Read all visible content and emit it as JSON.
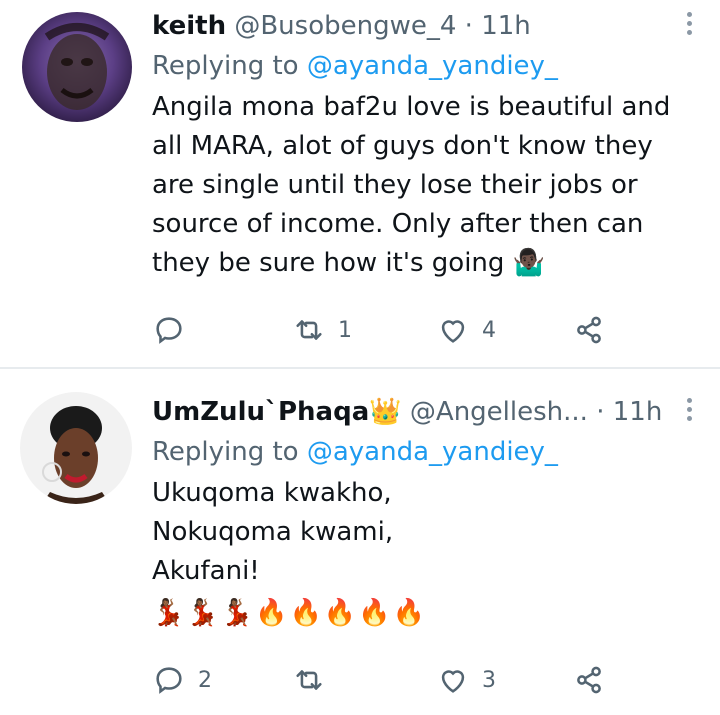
{
  "tweets": [
    {
      "name": "keith",
      "handle": "@Busobengwe_4",
      "separator": "·",
      "time": "11h",
      "replying_prefix": "Replying to",
      "replying_to": "@ayanda_yandiey_",
      "text": "Angila mona baf2u love is beautiful and all MARA, alot of guys don't know they are single until they lose their jobs or source of income. Only after then can they be sure how it's going",
      "emoji": "🤷🏿‍♂️",
      "reply_count": "",
      "retweet_count": "1",
      "like_count": "4"
    },
    {
      "name": "UmZulu`Phaqa",
      "name_emoji": "👑",
      "handle": "@Angellesh...",
      "separator": "·",
      "time": "11h",
      "replying_prefix": "Replying to",
      "replying_to": "@ayanda_yandiey_",
      "lines": [
        "Ukuqoma kwakho,",
        "Nokuqoma kwami,",
        "Akufani!"
      ],
      "emoji_row": [
        "💃🏾",
        "💃🏾",
        "💃🏾",
        "🔥",
        "🔥",
        "🔥",
        "🔥",
        "🔥"
      ],
      "reply_count": "2",
      "retweet_count": "",
      "like_count": "3"
    }
  ],
  "colors": {
    "text": "#0f1419",
    "secondary": "#536471",
    "mention": "#1d9bf0",
    "divider": "#e7ebee"
  },
  "icons": [
    "reply-icon",
    "retweet-icon",
    "like-icon",
    "share-icon",
    "more-icon"
  ]
}
